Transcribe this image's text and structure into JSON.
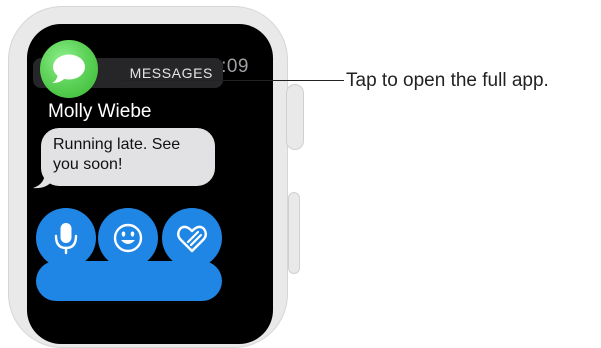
{
  "watch": {
    "time": "10:09",
    "app_name": "MESSAGES",
    "app_icon": "messages-bubble-icon",
    "sender": "Molly Wiebe",
    "message": "Running late. See you soon!",
    "actions": [
      {
        "icon": "microphone-icon"
      },
      {
        "icon": "emoji-icon"
      },
      {
        "icon": "heart-sketch-icon"
      }
    ]
  },
  "callout": {
    "text": "Tap to open the full app."
  },
  "colors": {
    "screen_bg": "#000000",
    "case": "#e9e9ea",
    "accent_blue": "#1f86e6",
    "messages_green": "#4cd147",
    "bubble_gray": "#e2e2e5"
  }
}
